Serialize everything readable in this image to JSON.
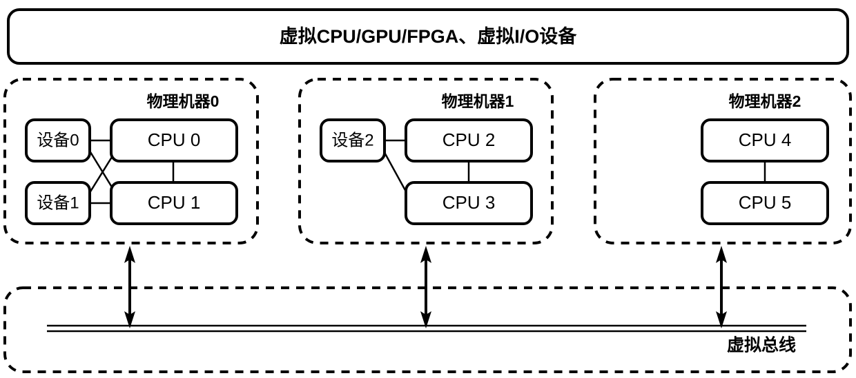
{
  "banner": {
    "label": "虚拟CPU/GPU/FPGA、虚拟I/O设备"
  },
  "machines": [
    {
      "label": "物理机器0",
      "devices": [
        {
          "label": "设备0"
        },
        {
          "label": "设备1"
        }
      ],
      "cpus": [
        {
          "label": "CPU 0"
        },
        {
          "label": "CPU 1"
        }
      ]
    },
    {
      "label": "物理机器1",
      "devices": [
        {
          "label": "设备2"
        }
      ],
      "cpus": [
        {
          "label": "CPU 2"
        },
        {
          "label": "CPU 3"
        }
      ]
    },
    {
      "label": "物理机器2",
      "devices": [],
      "cpus": [
        {
          "label": "CPU 4"
        },
        {
          "label": "CPU 5"
        }
      ]
    }
  ],
  "bus": {
    "label": "虚拟总线"
  },
  "colors": {
    "stroke": "#000000",
    "fill": "#ffffff",
    "text": "#000000"
  }
}
